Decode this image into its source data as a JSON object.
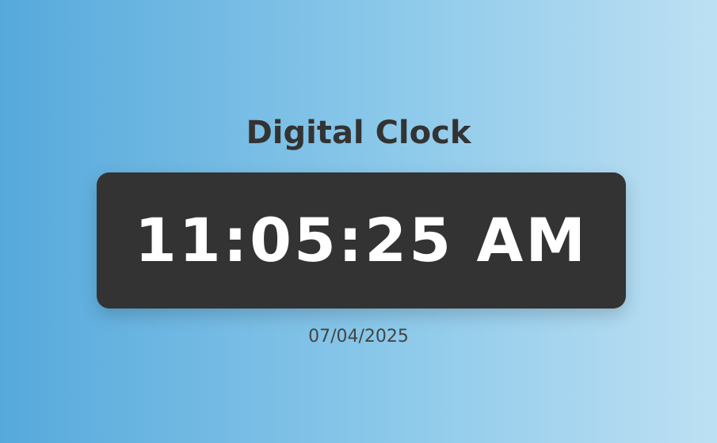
{
  "app": {
    "title": "Digital Clock"
  },
  "clock": {
    "time": "11:05:25 AM",
    "date": "07/04/2025"
  },
  "colors": {
    "gradient_start": "#56a9dc",
    "gradient_end": "#bde0f3",
    "panel": "#333333",
    "time_text": "#ffffff",
    "title_text": "#333333",
    "date_text": "#444444"
  }
}
